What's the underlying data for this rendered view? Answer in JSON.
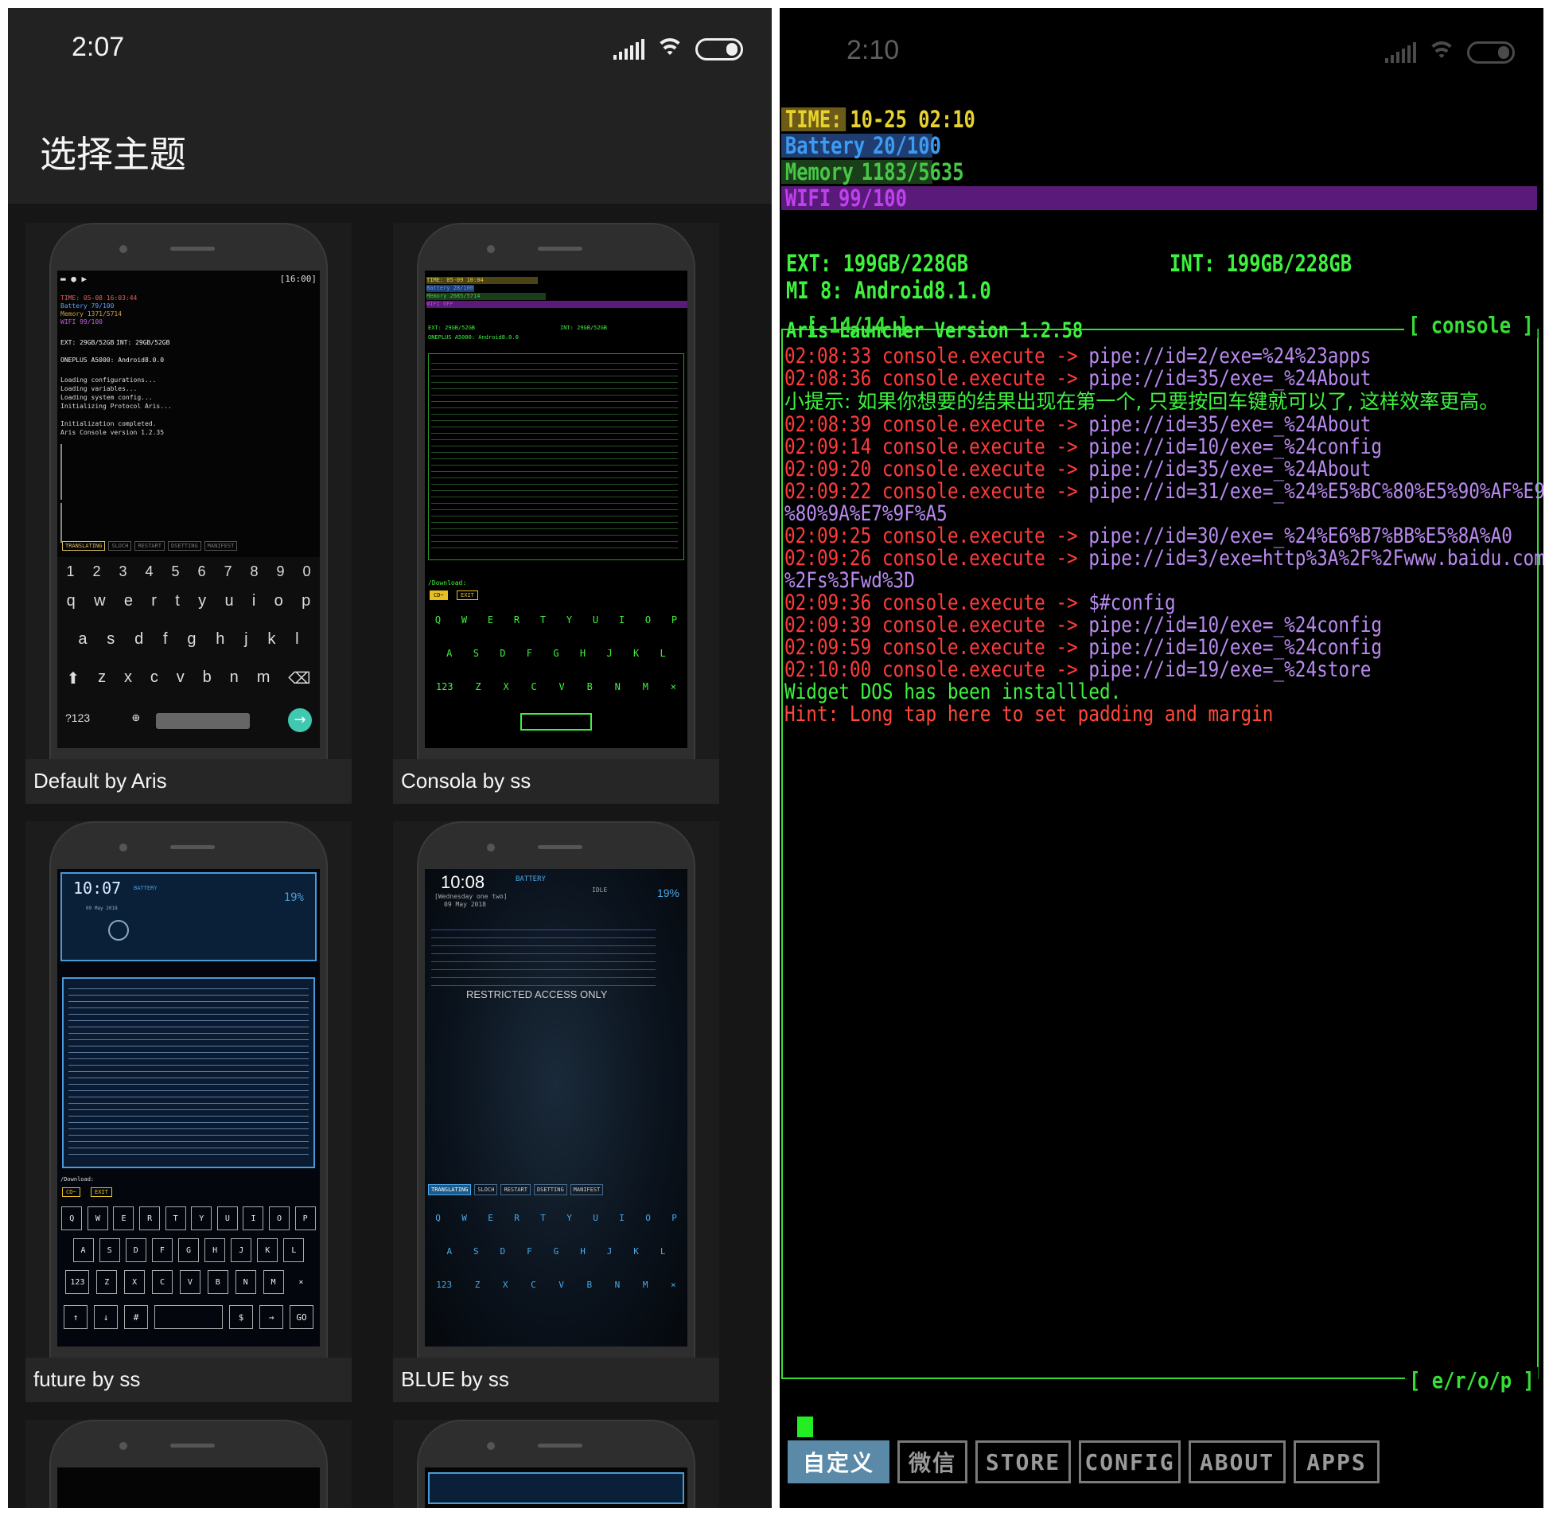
{
  "left": {
    "status_time": "2:07",
    "page_title": "选择主题",
    "themes": [
      {
        "caption": "Default by Aris"
      },
      {
        "caption": "Consola by ss"
      },
      {
        "caption": "future by ss"
      },
      {
        "caption": "BLUE by ss"
      }
    ],
    "default_preview": {
      "status": "[16:00]",
      "time": "TIME:  05-08 16:03:44",
      "battery": "Battery 79/100",
      "memory": "Memory  1371/5714",
      "wifi": "WIFI    99/100",
      "ext": "EXT: 29GB/52GB",
      "int": "INT: 29GB/52GB",
      "device": "ONEPLUS A5000: Android8.0.0",
      "lines": [
        "Loading configurations...",
        "Loading variables...",
        "Loading system config...",
        "Initializing Protocol Aris...",
        "",
        "Initialization completed.",
        "Aris Console version 1.2.35"
      ],
      "toolbar": [
        "TRANSLATING",
        "SLOCH",
        "RESTART",
        "DSETTING",
        "MANIFEST"
      ],
      "kb_nums": [
        "1",
        "2",
        "3",
        "4",
        "5",
        "6",
        "7",
        "8",
        "9",
        "0"
      ],
      "kb_row1": [
        "q",
        "w",
        "e",
        "r",
        "t",
        "y",
        "u",
        "i",
        "o",
        "p"
      ],
      "kb_row2": [
        "a",
        "s",
        "d",
        "f",
        "g",
        "h",
        "j",
        "k",
        "l"
      ],
      "kb_row3": [
        "z",
        "x",
        "c",
        "v",
        "b",
        "n",
        "m"
      ],
      "kb_sym": "?123"
    },
    "consola_preview": {
      "time": "TIME:  05-09 10:04",
      "battery": "Battery 28/100",
      "memory": "Memory  2685/5714",
      "wifi": "WIFI    OFF",
      "ext": "EXT: 29GB/52GB",
      "int": "INT: 29GB/52GB",
      "device": "ONEPLUS A5000: Android8.0.0",
      "download": "/Download:",
      "btns": [
        "CD~",
        "EXIT"
      ],
      "kb_row1": [
        "Q",
        "W",
        "E",
        "R",
        "T",
        "Y",
        "U",
        "I",
        "O",
        "P"
      ],
      "kb_row2": [
        "A",
        "S",
        "D",
        "F",
        "G",
        "H",
        "J",
        "K",
        "L"
      ],
      "kb_row3": [
        "123",
        "Z",
        "X",
        "C",
        "V",
        "B",
        "N",
        "M",
        "×"
      ]
    },
    "future_preview": {
      "time": "10:07",
      "battery_label": "BATTERY",
      "percent": "19%",
      "date": "09 May 2018",
      "download": "/Download:",
      "btns": [
        "CD~",
        "EXIT"
      ],
      "kb_row1": [
        "Q",
        "W",
        "E",
        "R",
        "T",
        "Y",
        "U",
        "I",
        "O",
        "P"
      ],
      "kb_row2": [
        "A",
        "S",
        "D",
        "F",
        "G",
        "H",
        "J",
        "K",
        "L"
      ],
      "kb_row3": [
        "123",
        "Z",
        "X",
        "C",
        "V",
        "B",
        "N",
        "M",
        "×"
      ],
      "kb_row4": [
        "↑",
        "↓",
        "#",
        "",
        "$",
        "→",
        "GO"
      ]
    },
    "blue_preview": {
      "time": "10:08",
      "battery_label": "BATTERY",
      "idle": "IDLE",
      "percent": "19%",
      "weekday": "[Wednesday one two]",
      "date": "09 May 2018",
      "restricted": "RESTRICTED ACCESS ONLY",
      "toolbar": [
        "TRANSLATING",
        "SLOCH",
        "RESTART",
        "DSETTING",
        "MANIFEST"
      ],
      "kb_row1": [
        "Q",
        "W",
        "E",
        "R",
        "T",
        "Y",
        "U",
        "I",
        "O",
        "P"
      ],
      "kb_row2": [
        "A",
        "S",
        "D",
        "F",
        "G",
        "H",
        "J",
        "K",
        "L"
      ],
      "kb_row3": [
        "123",
        "Z",
        "X",
        "C",
        "V",
        "B",
        "N",
        "M",
        "×"
      ]
    }
  },
  "right": {
    "status_time": "2:10",
    "stats": [
      {
        "label": "TIME:",
        "value": "10-25 02:10",
        "label_bg": "#6b5a18",
        "label_color": "#e8d230",
        "value_color": "#e8d230",
        "bar_color": "#000000"
      },
      {
        "label": "Battery",
        "value": "20/100",
        "label_bg": "#1f3d70",
        "label_color": "#3c9cf4",
        "value_color": "#3c9cf4",
        "bar_color": "#1f3d70"
      },
      {
        "label": "Memory",
        "value": "1183/5635",
        "label_bg": "#1a3d1a",
        "label_color": "#46c846",
        "value_color": "#46c846",
        "bar_color": "#1a3d1a"
      },
      {
        "label": "WIFI",
        "value": "99/100",
        "label_bg": "#5a1a7a",
        "label_color": "#c040f0",
        "value_color": "#c040f0",
        "bar_color": "#5a1a7a"
      }
    ],
    "ext": "EXT: 199GB/228GB",
    "int": "INT: 199GB/228GB",
    "device": "MI 8: Android8.1.0",
    "version_line": "Aris Launcher Version 1.2.58",
    "count_tag": "[ 14/14 ]",
    "console_tag": "[ console ]",
    "output_tag": "[ e/r/o/p ]",
    "log": [
      {
        "ts": "02:08:33",
        "cmd": "console.execute ->",
        "arg": "pipe://id=2/exe=%24%23apps"
      },
      {
        "ts": "02:08:36",
        "cmd": "console.execute ->",
        "arg": "pipe://id=35/exe=_%24About"
      },
      {
        "tip": "小提示: 如果你想要的结果出现在第一个, 只要按回车键就可以了, 这样效率更高。"
      },
      {
        "ts": "02:08:39",
        "cmd": "console.execute ->",
        "arg": "pipe://id=35/exe=_%24About"
      },
      {
        "ts": "02:09:14",
        "cmd": "console.execute ->",
        "arg": "pipe://id=10/exe=_%24config"
      },
      {
        "ts": "02:09:20",
        "cmd": "console.execute ->",
        "arg": "pipe://id=35/exe=_%24About"
      },
      {
        "ts": "02:09:22",
        "cmd": "console.execute ->",
        "arg": "pipe://id=31/exe=_%24%E5%BC%80%E5%90%AF%E9",
        "cont": "%80%9A%E7%9F%A5"
      },
      {
        "ts": "02:09:25",
        "cmd": "console.execute ->",
        "arg": "pipe://id=30/exe=_%24%E6%B7%BB%E5%8A%A0"
      },
      {
        "ts": "02:09:26",
        "cmd": "console.execute ->",
        "arg": "pipe://id=3/exe=http%3A%2F%2Fwww.baidu.com",
        "cont": "%2Fs%3Fwd%3D"
      },
      {
        "ts": "02:09:36",
        "cmd": "console.execute ->",
        "arg": "$#config"
      },
      {
        "ts": "02:09:39",
        "cmd": "console.execute ->",
        "arg": "pipe://id=10/exe=_%24config"
      },
      {
        "ts": "02:09:59",
        "cmd": "console.execute ->",
        "arg": "pipe://id=10/exe=_%24config"
      },
      {
        "ts": "02:10:00",
        "cmd": "console.execute ->",
        "arg": "pipe://id=19/exe=_%24store"
      },
      {
        "green": "Widget DOS has been installled."
      },
      {
        "hint": "Hint: Long tap here to set padding and margin"
      }
    ],
    "tabs": [
      "自定义",
      "微信",
      "STORE",
      "CONFIG",
      "ABOUT",
      "APPS"
    ]
  }
}
